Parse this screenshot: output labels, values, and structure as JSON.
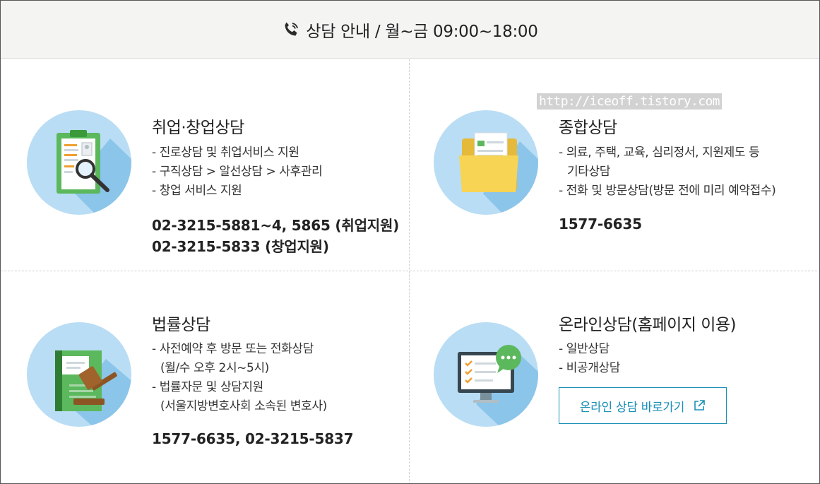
{
  "header": {
    "title": "상담 안내 / 월~금 09:00~18:00",
    "icon": "phone-icon"
  },
  "watermark": "http://iceoff.tistory.com",
  "cards": {
    "employment": {
      "title": "취업·창업상담",
      "icon": "clipboard-magnifier-icon",
      "items": [
        "- 진로상담 및 취업서비스 지원",
        "- 구직상담 > 알선상담 > 사후관리",
        "- 창업 서비스 지원"
      ],
      "phones": [
        "02-3215-5881~4, 5865 (취업지원)",
        "02-3215-5833 (창업지원)"
      ]
    },
    "general": {
      "title": "종합상담",
      "icon": "folder-icon",
      "items": [
        "- 의료, 주택, 교육, 심리정서, 지원제도 등",
        "기타상담",
        "- 전화 및 방문상담(방문 전에 미리 예약접수)"
      ],
      "phones": [
        "1577-6635"
      ]
    },
    "legal": {
      "title": "법률상담",
      "icon": "law-book-gavel-icon",
      "items": [
        "- 사전예약 후 방문 또는 전화상담",
        "(월/수 오후 2시~5시)",
        "- 법률자문 및 상담지원",
        "(서울지방변호사회 소속된 변호사)"
      ],
      "phones": [
        "1577-6635, 02-3215-5837"
      ]
    },
    "online": {
      "title": "온라인상담(홈페이지 이용)",
      "icon": "monitor-chat-icon",
      "items": [
        "- 일반상담",
        "- 비공개상담"
      ],
      "button_label": "온라인 상담 바로가기",
      "button_icon": "external-link-icon"
    }
  },
  "colors": {
    "circle": "#b9ddf4",
    "accent": "#1a8fb5",
    "header_bg": "#f4f4f2"
  }
}
